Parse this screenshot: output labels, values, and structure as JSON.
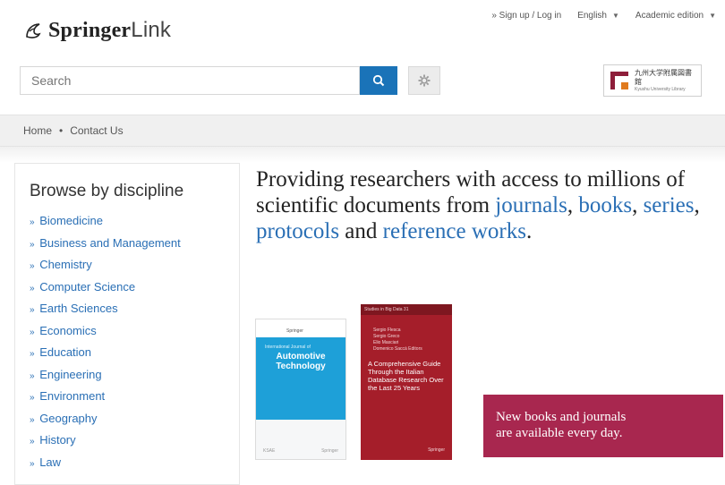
{
  "brand": {
    "name_bold": "Springer",
    "name_light": "Link"
  },
  "top_links": {
    "signup": "» Sign up / Log in",
    "language": "English",
    "edition": "Academic edition"
  },
  "search": {
    "placeholder": "Search"
  },
  "institution": {
    "name": "九州大学附属図書館",
    "subtitle": "Kyushu University Library"
  },
  "breadcrumb": {
    "home": "Home",
    "separator": "•",
    "contact": "Contact Us"
  },
  "sidebar": {
    "title": "Browse by discipline",
    "bullet": "»",
    "items": [
      {
        "label": "Biomedicine"
      },
      {
        "label": "Business and Management"
      },
      {
        "label": "Chemistry"
      },
      {
        "label": "Computer Science"
      },
      {
        "label": "Earth Sciences"
      },
      {
        "label": "Economics"
      },
      {
        "label": "Education"
      },
      {
        "label": "Engineering"
      },
      {
        "label": "Environment"
      },
      {
        "label": "Geography"
      },
      {
        "label": "History"
      },
      {
        "label": "Law"
      }
    ]
  },
  "hero": {
    "text1": "Providing researchers with access to millions of scientific documents from ",
    "link_journals": "journals",
    "comma1": ", ",
    "link_books": "books",
    "comma2": ", ",
    "link_series": "series",
    "comma3": ", ",
    "link_protocols": "protocols",
    "and": " and ",
    "link_reference": "reference works",
    "period": "."
  },
  "book1": {
    "top_small": "Springer",
    "title_line1": "International Journal of",
    "title_line2": "Automotive",
    "title_line3": "Technology",
    "footer_left": "KSAE",
    "footer_right": "Springer"
  },
  "book2": {
    "series": "Studies in Big Data  31",
    "authors": "Sergio Flesca\nSergio Greco\nElio Masciari\nDomenico Saccà  Editors",
    "title": "A Comprehensive Guide Through the Italian Database Research Over the Last 25 Years",
    "publisher": "Springer"
  },
  "promo": {
    "line1": "New books and journals",
    "line2": "are available every day."
  },
  "colors": {
    "accent": "#1a73b8",
    "link": "#2a6fb5",
    "promo": "#a8274f",
    "book_red": "#a51e2a",
    "journal_blue": "#1ea0d8"
  }
}
